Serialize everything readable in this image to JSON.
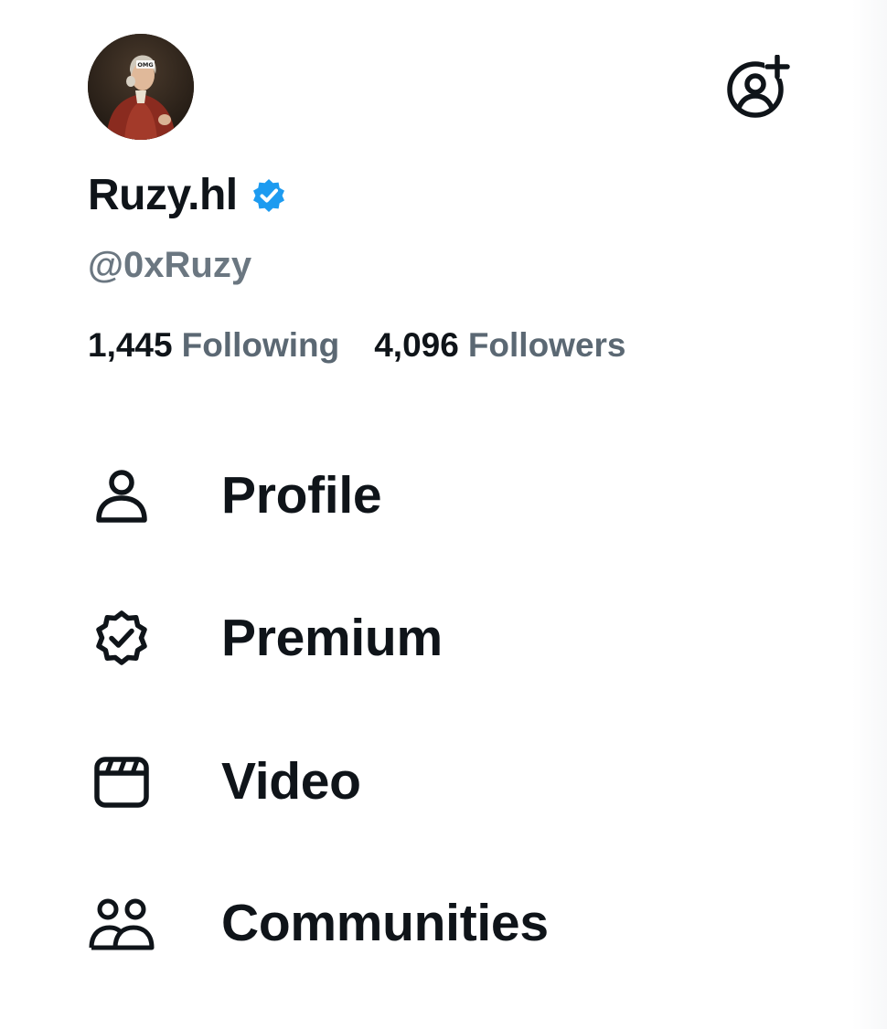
{
  "profile": {
    "avatar_text": "OMG",
    "display_name": "Ruzy.hl",
    "verified": true,
    "handle": "@0xRuzy",
    "following_count": "1,445",
    "following_label": "Following",
    "followers_count": "4,096",
    "followers_label": "Followers"
  },
  "icons": {
    "add_account": "add-account-icon",
    "verified": "verified-badge-icon"
  },
  "colors": {
    "text_primary": "#0f1419",
    "text_secondary": "#5b6873",
    "verified_blue": "#1d9bf0"
  },
  "nav": {
    "items": [
      {
        "label": "Profile",
        "icon": "person-icon"
      },
      {
        "label": "Premium",
        "icon": "premium-badge-icon"
      },
      {
        "label": "Video",
        "icon": "video-icon"
      },
      {
        "label": "Communities",
        "icon": "communities-icon"
      }
    ]
  }
}
